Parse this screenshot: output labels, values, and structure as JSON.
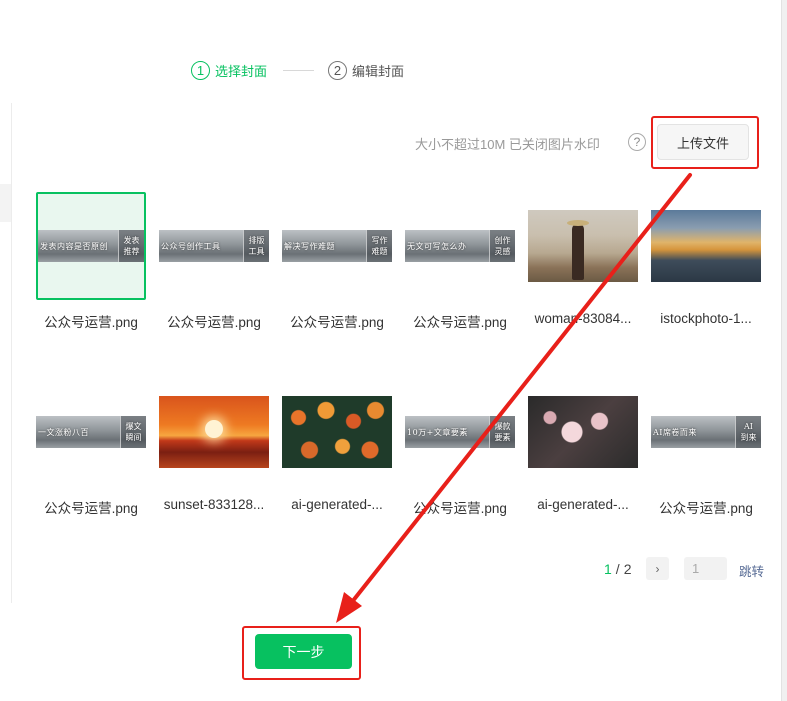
{
  "steps": [
    {
      "num": "1",
      "label": "选择封面",
      "active": true
    },
    {
      "num": "2",
      "label": "编辑封面",
      "active": false
    }
  ],
  "upload": {
    "hint": "大小不超过10M 已关闭图片水印",
    "help": "?",
    "button_label": "上传文件"
  },
  "images": [
    {
      "name": "公众号运营.png",
      "kind": "banner",
      "text": "发表内容是否原创",
      "side": [
        "发表",
        "推荐"
      ],
      "selected": true
    },
    {
      "name": "公众号运营.png",
      "kind": "banner",
      "text": "公众号创作工具",
      "side": [
        "排版",
        "工具"
      ],
      "selected": false
    },
    {
      "name": "公众号运营.png",
      "kind": "banner",
      "text": "解决写作难题",
      "side": [
        "写作",
        "难题"
      ],
      "selected": false
    },
    {
      "name": "公众号运营.png",
      "kind": "banner",
      "text": "无文可写怎么办",
      "side": [
        "创作",
        "灵感"
      ],
      "selected": false
    },
    {
      "name": "woman-83084...",
      "kind": "photo",
      "style": "woman",
      "selected": false
    },
    {
      "name": "istockphoto-1...",
      "kind": "photo",
      "style": "sea",
      "selected": false
    },
    {
      "name": "公众号运营.png",
      "kind": "banner",
      "text": "一文涨粉八百",
      "side": [
        "爆文",
        "瞬间"
      ],
      "selected": false
    },
    {
      "name": "sunset-833128...",
      "kind": "photo",
      "style": "sunset",
      "selected": false
    },
    {
      "name": "ai-generated-...",
      "kind": "photo",
      "style": "flowers",
      "selected": false
    },
    {
      "name": "公众号运营.png",
      "kind": "banner",
      "text": "10万+文章要素",
      "side": [
        "爆款",
        "要素"
      ],
      "selected": false
    },
    {
      "name": "ai-generated-...",
      "kind": "photo",
      "style": "blossom",
      "selected": false
    },
    {
      "name": "公众号运营.png",
      "kind": "banner",
      "text": "AI席卷而来",
      "side": [
        "AI",
        "到来"
      ],
      "selected": false
    }
  ],
  "pagination": {
    "current": "1",
    "separator": "/",
    "total": "2",
    "next": "›",
    "input_value": "1",
    "jump_label": "跳转"
  },
  "next_button": {
    "label": "下一步"
  },
  "colors": {
    "accent": "#07c160",
    "annotation": "#e8201a",
    "link": "#576b95"
  }
}
